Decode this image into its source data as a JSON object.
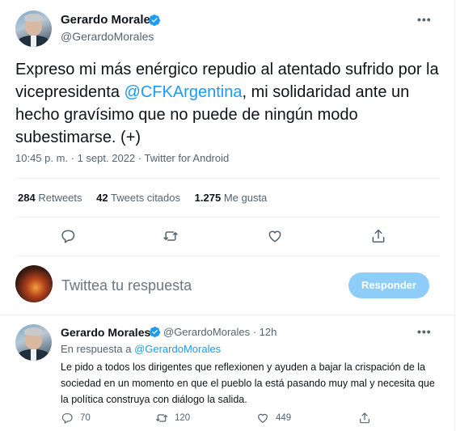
{
  "tweet": {
    "author_name": "Gerardo Morales",
    "author_handle": "@GerardoMorales",
    "text_before": "Expreso mi más enérgico repudio al atentado sufrido por la vicepresidenta ",
    "mention": "@CFKArgentina",
    "text_after": ", mi solidaridad ante un hecho gravísimo que no puede de ningún modo subestimarse. (+)",
    "meta": "10:45 p. m. · 1 sept. 2022 · Twitter for Android",
    "stats": {
      "retweets_count": "284",
      "retweets_label": "Retweets",
      "quotes_count": "42",
      "quotes_label": "Tweets citados",
      "likes_count": "1.275",
      "likes_label": "Me gusta"
    }
  },
  "composer": {
    "placeholder": "Twittea tu respuesta",
    "reply_button": "Responder"
  },
  "reply": {
    "author_name": "Gerardo Morales",
    "author_handle_time": "@GerardoMorales · 12h",
    "in_reply_prefix": "En respuesta a ",
    "in_reply_handle": "@GerardoMorales",
    "text": "Le pido a todos los dirigentes que reflexionen y ayuden a bajar la crispación de la sociedad en un momento en que el pueblo la está pasando muy mal y necesita que la política construya con diálogo la salida.",
    "replies": "70",
    "retweets": "120",
    "likes": "449"
  },
  "colors": {
    "accent": "#1d9bf0",
    "secondary_text": "#536471",
    "reply_button_disabled": "#8ecdf7"
  }
}
